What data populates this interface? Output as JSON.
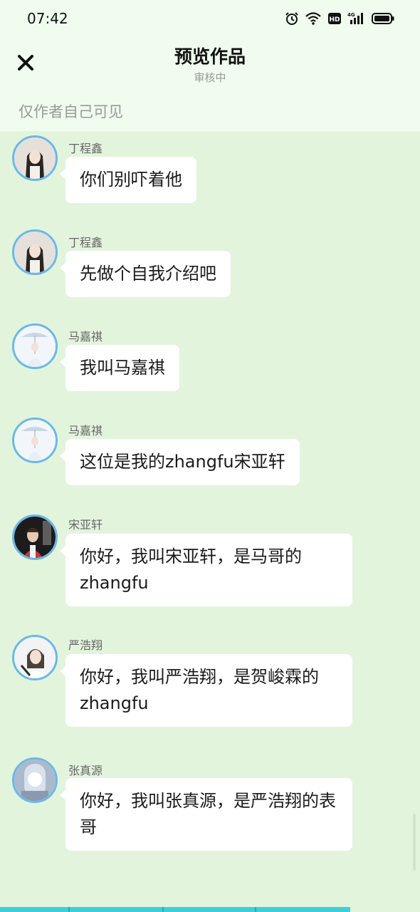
{
  "status_bar": {
    "time": "07:42",
    "hd_label": "HD",
    "network_label": "4G"
  },
  "header": {
    "title": "预览作品",
    "subtitle": "审核中",
    "visibility_note": "仅作者自己可见"
  },
  "messages": [
    {
      "sender": "丁程鑫",
      "text": "你们别吓着他"
    },
    {
      "sender": "丁程鑫",
      "text": "先做个自我介绍吧"
    },
    {
      "sender": "马嘉祺",
      "text": "我叫马嘉祺"
    },
    {
      "sender": "马嘉祺",
      "text": "这位是我的zhangfu宋亚轩"
    },
    {
      "sender": "宋亚轩",
      "text": "你好，我叫宋亚轩，是马哥的zhangfu"
    },
    {
      "sender": "严浩翔",
      "text": "你好，我叫严浩翔，是贺峻霖的zhangfu"
    },
    {
      "sender": "张真源",
      "text": "你好，我叫张真源，是严浩翔的表哥"
    }
  ],
  "colors": {
    "chat_background": "#e3f4dd",
    "header_background": "#effcee",
    "avatar_ring": "#6ab8e8",
    "bubble": "#ffffff"
  }
}
